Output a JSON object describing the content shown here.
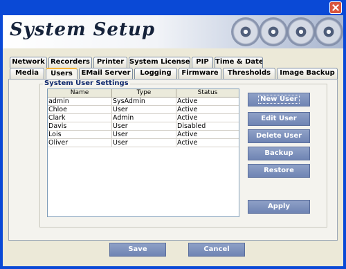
{
  "title": "System Setup",
  "tabs_row1": [
    "Network",
    "Recorders",
    "Printer",
    "System License",
    "PIP",
    "Time & Date"
  ],
  "tabs_row2": [
    "Media",
    "Users",
    "EMail Server",
    "Logging",
    "Firmware",
    "Thresholds",
    "Image Backup"
  ],
  "active_tab": "Users",
  "group_label": "System User Settings",
  "table": {
    "columns": [
      "Name",
      "Type",
      "Status"
    ],
    "rows": [
      [
        "admin",
        "SysAdmin",
        "Active"
      ],
      [
        "Chloe",
        "User",
        "Active"
      ],
      [
        "Clark",
        "Admin",
        "Active"
      ],
      [
        "Davis",
        "User",
        "Disabled"
      ],
      [
        "Lois",
        "User",
        "Active"
      ],
      [
        "Oliver",
        "User",
        "Active"
      ]
    ]
  },
  "buttons": {
    "new_user": "New User",
    "edit_user": "Edit User",
    "delete_user": "Delete User",
    "backup": "Backup",
    "restore": "Restore",
    "apply": "Apply"
  },
  "footer": {
    "save": "Save",
    "cancel": "Cancel"
  },
  "colors": {
    "titlebar": "#0a49d6",
    "button": "#7a8dbb",
    "active_tab_accent": "#f6b63a"
  }
}
